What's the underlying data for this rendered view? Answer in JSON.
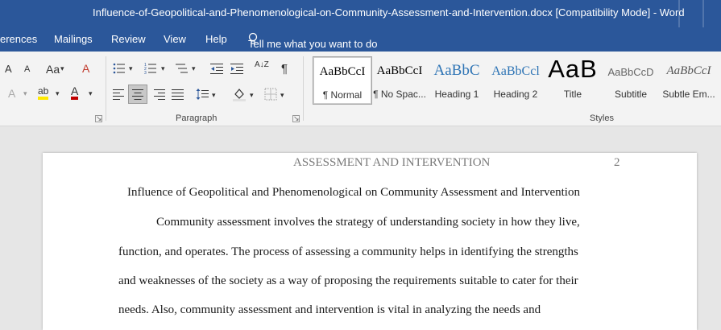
{
  "window": {
    "title": "Influence-of-Geopolitical-and-Phenomenological-on-Community-Assessment-and-Intervention.docx [Compatibility Mode]  -  Word"
  },
  "tabs": [
    "erences",
    "Mailings",
    "Review",
    "View",
    "Help"
  ],
  "tell_me": "Tell me what you want to do",
  "ribbon": {
    "font_group": {
      "grow": "A",
      "shrink": "A",
      "case": "Aa",
      "clear_format": "A",
      "text_effects": "A",
      "highlight": "ab",
      "font_color": "A"
    },
    "paragraph_label": "Paragraph",
    "styles_label": "Styles",
    "pilcrow": "¶",
    "sort": "A↓Z"
  },
  "styles": [
    {
      "preview": "AaBbCcI",
      "name": "¶ Normal"
    },
    {
      "preview": "AaBbCcI",
      "name": "¶ No Spac..."
    },
    {
      "preview": "AaBbC",
      "name": "Heading 1"
    },
    {
      "preview": "AaBbCcl",
      "name": "Heading 2"
    },
    {
      "preview": "AaB",
      "name": "Title"
    },
    {
      "preview": "AaBbCcD",
      "name": "Subtitle"
    },
    {
      "preview": "AaBbCcI",
      "name": "Subtle Em..."
    }
  ],
  "document": {
    "running_head": "ASSESSMENT AND INTERVENTION",
    "page_number": "2",
    "heading": "Influence of Geopolitical and Phenomenological on Community Assessment and Intervention",
    "lines": [
      "Community assessment involves the strategy of understanding society in how they live,",
      "function, and operates. The process of assessing a community helps in identifying the strengths",
      "and weaknesses of the society as a way of proposing the requirements suitable to cater for their",
      "needs. Also, community assessment and intervention is vital in analyzing the needs and"
    ]
  },
  "colors": {
    "brand": "#2b579a",
    "ribbon_bg": "#f3f3f3",
    "canvas": "#e6e6e6"
  }
}
